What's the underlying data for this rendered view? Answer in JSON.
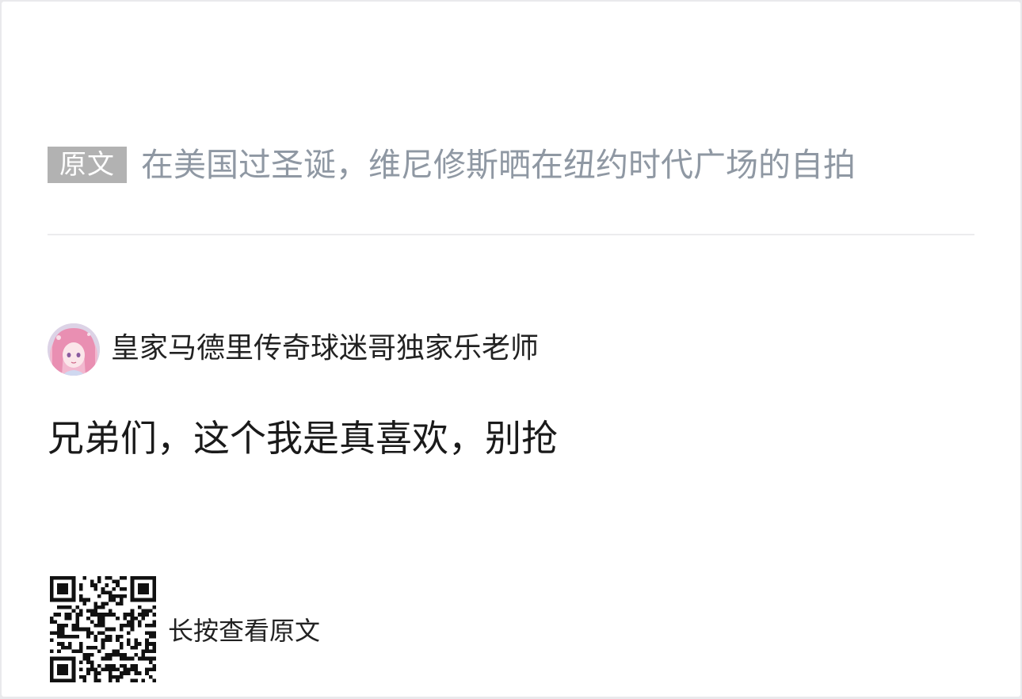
{
  "origin": {
    "badge_label": "原文",
    "title": "在美国过圣诞，维尼修斯晒在纽约时代广场的自拍"
  },
  "author": {
    "name": "皇家马德里传奇球迷哥独家乐老师",
    "avatar_icon": "avatar-anime-girl-icon"
  },
  "post": {
    "text": "兄弟们，这个我是真喜欢，别抢"
  },
  "qr": {
    "icon": "qr-code-icon",
    "label": "长按查看原文"
  },
  "colors": {
    "badge_bg": "#b2b2b2",
    "origin_title": "#8f98a3",
    "text": "#1a1a1a",
    "divider": "#ececee"
  }
}
